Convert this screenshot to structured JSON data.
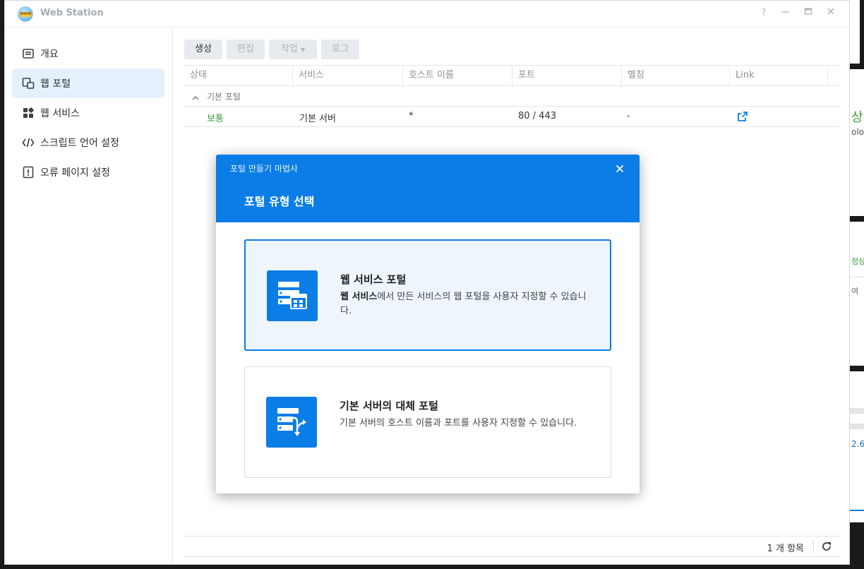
{
  "window": {
    "title": "Web Station",
    "controls": [
      "help-icon",
      "minimize-icon",
      "maximize-icon",
      "close-icon"
    ]
  },
  "sidebar": {
    "items": [
      {
        "label": "개요",
        "icon": "overview-icon",
        "active": false
      },
      {
        "label": "웹 포털",
        "icon": "web-portal-icon",
        "active": true
      },
      {
        "label": "웹 서비스",
        "icon": "web-service-icon",
        "active": false
      },
      {
        "label": "스크립트 언어 설정",
        "icon": "code-icon",
        "active": false
      },
      {
        "label": "오류 페이지 설정",
        "icon": "error-page-icon",
        "active": false
      }
    ]
  },
  "toolbar": {
    "create": "생성",
    "edit": "편집",
    "action": "작업",
    "log": "로그"
  },
  "grid": {
    "columns": [
      "상태",
      "서비스",
      "호스트 이름",
      "포트",
      "별칭",
      "Link"
    ],
    "group": "기본 포털",
    "rows": [
      {
        "status": "보통",
        "service": "기본 서버",
        "host": "*",
        "port": "80 / 443",
        "alias": "-"
      }
    ]
  },
  "footer": {
    "count": "1 개 항목"
  },
  "modal": {
    "subtitle": "포털 만들기 마법사",
    "title": "포털 유형 선택",
    "options": [
      {
        "title": "웹 서비스 포털",
        "desc_bold": "웹 서비스",
        "desc_rest": "에서 만든 서비스의 웹 포털을 사용자 지정할 수 있습니다.",
        "icon": "web-service-portal-icon",
        "selected": true
      },
      {
        "title": "기본 서버의 대체 포털",
        "desc": "기본 서버의 호스트 이름과 포트를 사용자 지정할 수 있습니다.",
        "icon": "alternative-portal-icon",
        "selected": false
      }
    ]
  },
  "background": {
    "fragments": [
      "상",
      "olo",
      "정상",
      "여",
      "2.6"
    ]
  },
  "colors": {
    "accent": "#0b7de6",
    "status_ok": "#3a9a3a",
    "sidebar_active": "#e4f0fc"
  }
}
